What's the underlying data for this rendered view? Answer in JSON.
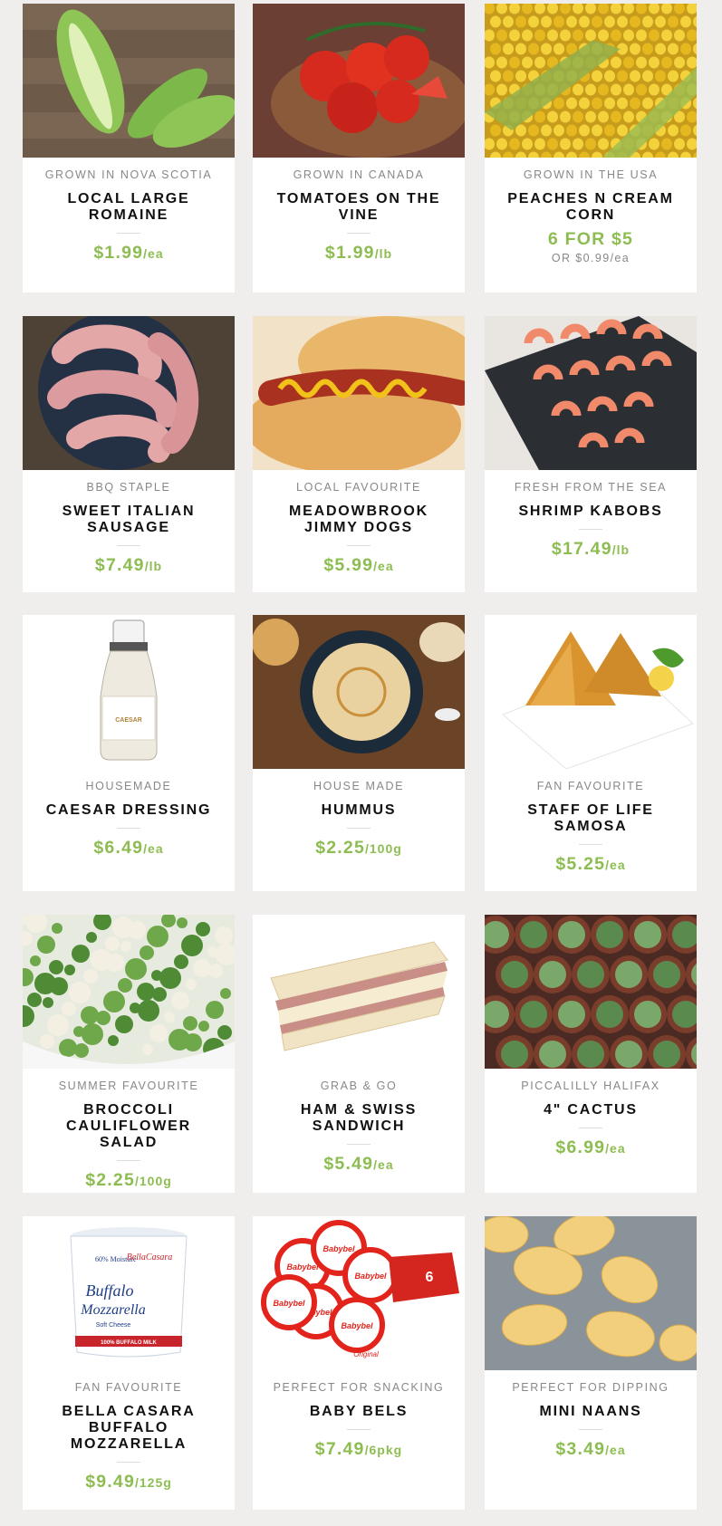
{
  "accent_color": "#8dbd52",
  "products": [
    {
      "tag": "GROWN IN NOVA SCOTIA",
      "name": "LOCAL LARGE ROMAINE",
      "price": "$1.99",
      "unit": "/ea",
      "image": "romaine"
    },
    {
      "tag": "GROWN IN CANADA",
      "name": "TOMATOES ON THE VINE",
      "price": "$1.99",
      "unit": "/lb",
      "image": "tomatoes"
    },
    {
      "tag": "GROWN IN THE USA",
      "name": "PEACHES N CREAM CORN",
      "price": "6 FOR $5",
      "unit": "",
      "sub": "OR $0.99/ea",
      "image": "corn"
    },
    {
      "tag": "BBQ STAPLE",
      "name": "SWEET ITALIAN SAUSAGE",
      "price": "$7.49",
      "unit": "/lb",
      "image": "sausage"
    },
    {
      "tag": "LOCAL FAVOURITE",
      "name": "MEADOWBROOK JIMMY DOGS",
      "price": "$5.99",
      "unit": "/ea",
      "image": "hotdog"
    },
    {
      "tag": "FRESH FROM THE SEA",
      "name": "SHRIMP KABOBS",
      "price": "$17.49",
      "unit": "/lb",
      "image": "shrimp"
    },
    {
      "tag": "HOUSEMADE",
      "name": "CAESAR DRESSING",
      "price": "$6.49",
      "unit": "/ea",
      "image": "dressing",
      "bottle_label": "CAESAR"
    },
    {
      "tag": "HOUSE MADE",
      "name": "HUMMUS",
      "price": "$2.25",
      "unit": "/100g",
      "image": "hummus"
    },
    {
      "tag": "FAN FAVOURITE",
      "name": "STAFF OF LIFE SAMOSA",
      "price": "$5.25",
      "unit": "/ea",
      "image": "samosa"
    },
    {
      "tag": "SUMMER FAVOURITE",
      "name": "BROCCOLI CAULIFLOWER SALAD",
      "price": "$2.25",
      "unit": "/100g",
      "image": "salad"
    },
    {
      "tag": "GRAB & GO",
      "name": "HAM & SWISS SANDWICH",
      "price": "$5.49",
      "unit": "/ea",
      "image": "sandwich"
    },
    {
      "tag": "PICCALILLY HALIFAX",
      "name": "4\" CACTUS",
      "price": "$6.99",
      "unit": "/ea",
      "image": "cactus"
    },
    {
      "tag": "FAN FAVOURITE",
      "name": "BELLA CASARA BUFFALO MOZZARELLA",
      "price": "$9.49",
      "unit": "/125g",
      "image": "mozzarella",
      "package_text": [
        "60% Moisture",
        "BellaCasara",
        "Buffalo",
        "Mozzarella",
        "Soft Cheese",
        "100% BUFFALO MILK"
      ]
    },
    {
      "tag": "PERFECT FOR SNACKING",
      "name": "BABY BELS",
      "price": "$7.49",
      "unit": "/6pkg",
      "image": "babybel",
      "package_text": [
        "Babybel",
        "6",
        "Original"
      ]
    },
    {
      "tag": "PERFECT FOR DIPPING",
      "name": "MINI NAANS",
      "price": "$3.49",
      "unit": "/ea",
      "image": "naan"
    }
  ]
}
